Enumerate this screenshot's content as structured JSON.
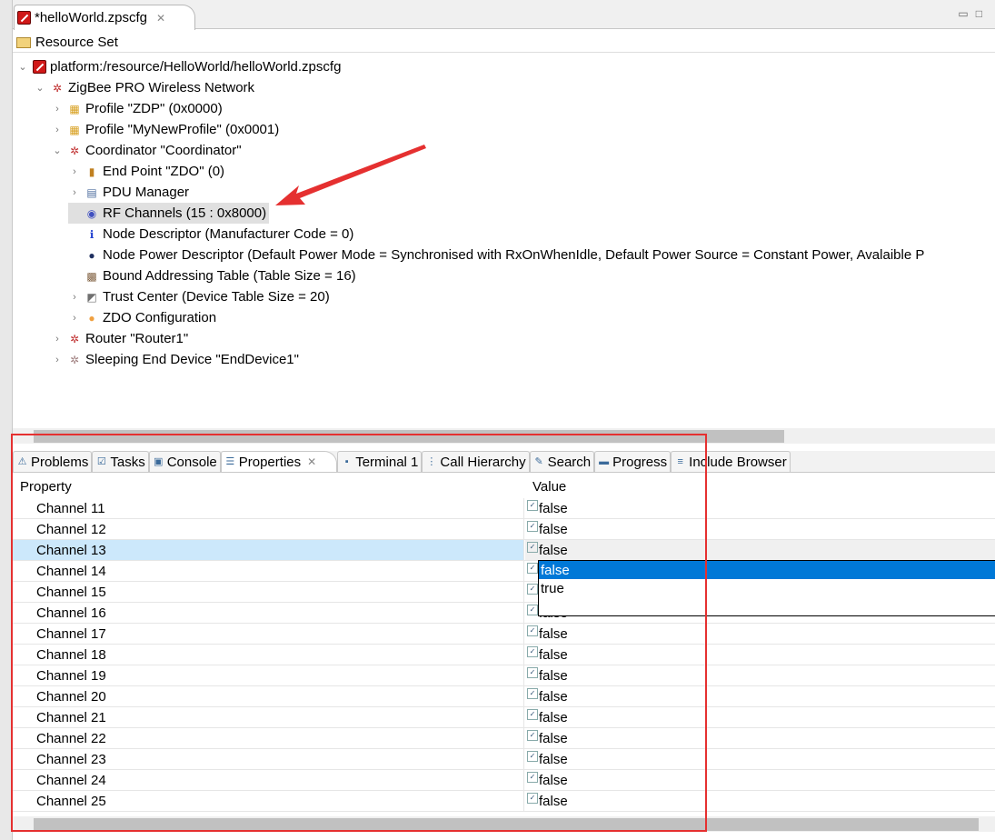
{
  "editor_tab": {
    "title": "*helloWorld.zpscfg"
  },
  "resource_set": "Resource Set",
  "tree": [
    {
      "label": "platform:/resource/HelloWorld/helloWorld.zpscfg",
      "level": 0,
      "expander": "expanded",
      "icon": "zpscfg-file-icon"
    },
    {
      "label": "ZigBee PRO Wireless Network",
      "level": 1,
      "expander": "expanded",
      "icon": "zigbee-network-icon"
    },
    {
      "label": "Profile \"ZDP\" (0x0000)",
      "level": 2,
      "expander": "collapsed",
      "icon": "profile-icon"
    },
    {
      "label": "Profile \"MyNewProfile\" (0x0001)",
      "level": 2,
      "expander": "collapsed",
      "icon": "profile-icon"
    },
    {
      "label": "Coordinator \"Coordinator\"",
      "level": 2,
      "expander": "expanded",
      "icon": "coordinator-icon"
    },
    {
      "label": "End Point \"ZDO\" (0)",
      "level": 3,
      "expander": "collapsed",
      "icon": "endpoint-icon"
    },
    {
      "label": "PDU Manager",
      "level": 3,
      "expander": "collapsed",
      "icon": "pdu-manager-icon"
    },
    {
      "label": "RF Channels (15 : 0x8000)",
      "level": 3,
      "expander": "none",
      "icon": "rf-channels-icon",
      "selected": true
    },
    {
      "label": "Node Descriptor (Manufacturer Code = 0)",
      "level": 3,
      "expander": "none",
      "icon": "info-icon"
    },
    {
      "label": "Node Power Descriptor (Default Power Mode = Synchronised with RxOnWhenIdle, Default Power Source = Constant Power, Avalaible P",
      "level": 3,
      "expander": "none",
      "icon": "power-descriptor-icon"
    },
    {
      "label": "Bound Addressing Table (Table Size = 16)",
      "level": 3,
      "expander": "none",
      "icon": "table-icon"
    },
    {
      "label": "Trust Center (Device Table Size = 20)",
      "level": 3,
      "expander": "collapsed",
      "icon": "trust-center-icon"
    },
    {
      "label": "ZDO Configuration",
      "level": 3,
      "expander": "collapsed",
      "icon": "zdo-config-icon"
    },
    {
      "label": "Router \"Router1\"",
      "level": 2,
      "expander": "collapsed",
      "icon": "router-icon"
    },
    {
      "label": "Sleeping End Device \"EndDevice1\"",
      "level": 2,
      "expander": "collapsed",
      "icon": "end-device-icon"
    }
  ],
  "bottom_tabs": [
    {
      "label": "Problems",
      "icon": "problems-icon"
    },
    {
      "label": "Tasks",
      "icon": "tasks-icon"
    },
    {
      "label": "Console",
      "icon": "console-icon"
    },
    {
      "label": "Properties",
      "icon": "properties-icon",
      "active": true
    },
    {
      "label": "Terminal 1",
      "icon": "terminal-icon"
    },
    {
      "label": "Call Hierarchy",
      "icon": "call-hierarchy-icon"
    },
    {
      "label": "Search",
      "icon": "search-icon"
    },
    {
      "label": "Progress",
      "icon": "progress-icon"
    },
    {
      "label": "Include Browser",
      "icon": "include-browser-icon"
    }
  ],
  "properties": {
    "headers": {
      "property": "Property",
      "value": "Value"
    },
    "rows": [
      {
        "name": "Channel 11",
        "value": "false"
      },
      {
        "name": "Channel 12",
        "value": "false"
      },
      {
        "name": "Channel 13",
        "value": "false",
        "selected": true
      },
      {
        "name": "Channel 14",
        "value": "false"
      },
      {
        "name": "Channel 15",
        "value": "false"
      },
      {
        "name": "Channel 16",
        "value": "false"
      },
      {
        "name": "Channel 17",
        "value": "false"
      },
      {
        "name": "Channel 18",
        "value": "false"
      },
      {
        "name": "Channel 19",
        "value": "false"
      },
      {
        "name": "Channel 20",
        "value": "false"
      },
      {
        "name": "Channel 21",
        "value": "false"
      },
      {
        "name": "Channel 22",
        "value": "false"
      },
      {
        "name": "Channel 23",
        "value": "false"
      },
      {
        "name": "Channel 24",
        "value": "false"
      },
      {
        "name": "Channel 25",
        "value": "false"
      }
    ],
    "dropdown": {
      "options": [
        "false",
        "true"
      ],
      "highlighted": "false"
    }
  },
  "colors": {
    "annotation": "#e53030",
    "selection": "#0078d7",
    "row_selected": "#cce8fb"
  }
}
